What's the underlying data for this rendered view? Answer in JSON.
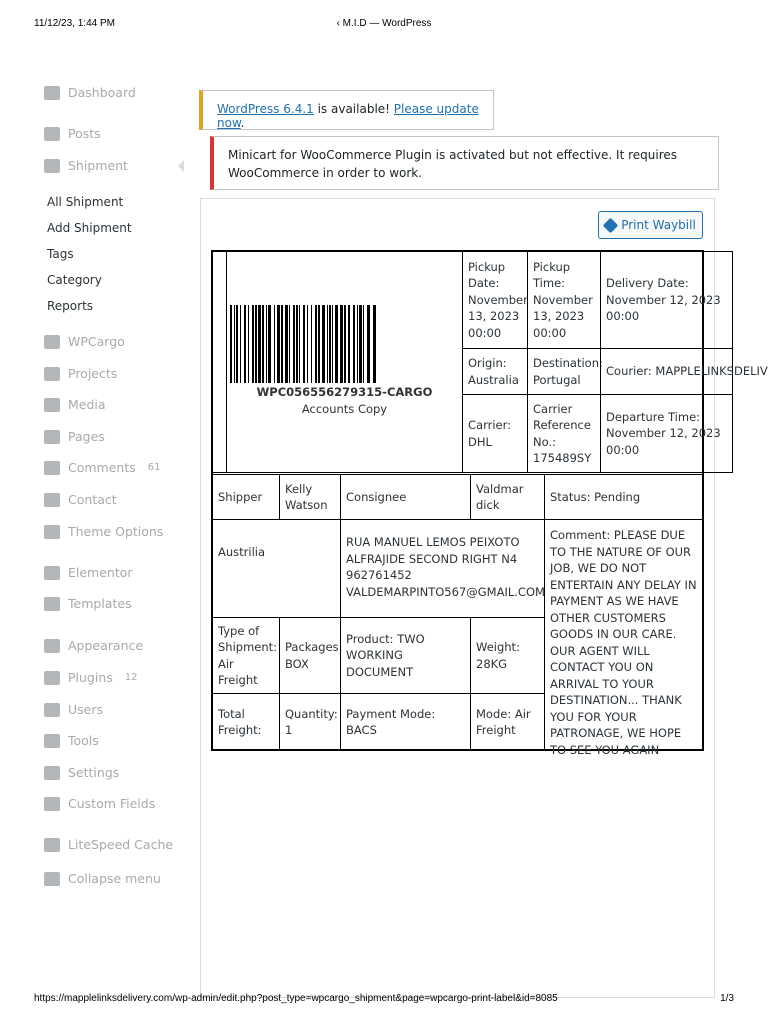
{
  "browser": {
    "datetime": "11/12/23, 1:44 PM",
    "title": "‹ M.I.D — WordPress",
    "url": "https://mapplelinksdelivery.com/wp-admin/edit.php?post_type=wpcargo_shipment&page=wpcargo-print-label&id=8085",
    "page": "1/3"
  },
  "sidebar": {
    "items": [
      {
        "label": "Dashboard",
        "icon": "dashboard-icon"
      },
      {
        "label": "Posts",
        "icon": "pin-icon"
      },
      {
        "label": "Shipment",
        "icon": "shipment-icon"
      },
      {
        "label": "WPCargo",
        "icon": "book-icon"
      },
      {
        "label": "Projects",
        "icon": "folder-icon"
      },
      {
        "label": "Media",
        "icon": "media-icon"
      },
      {
        "label": "Pages",
        "icon": "pages-icon"
      },
      {
        "label": "Comments",
        "icon": "comment-icon",
        "count": "61"
      },
      {
        "label": "Contact",
        "icon": "mail-icon"
      },
      {
        "label": "Theme Options",
        "icon": "gear-icon"
      },
      {
        "label": "Elementor",
        "icon": "elementor-icon"
      },
      {
        "label": "Templates",
        "icon": "folder-icon"
      },
      {
        "label": "Appearance",
        "icon": "brush-icon"
      },
      {
        "label": "Plugins",
        "icon": "plugin-icon",
        "count": "12"
      },
      {
        "label": "Users",
        "icon": "user-icon"
      },
      {
        "label": "Tools",
        "icon": "wrench-icon"
      },
      {
        "label": "Settings",
        "icon": "settings-icon"
      },
      {
        "label": "Custom Fields",
        "icon": "fields-icon"
      },
      {
        "label": "LiteSpeed Cache",
        "icon": "litespeed-icon"
      },
      {
        "label": "Collapse menu",
        "icon": "collapse-icon"
      }
    ],
    "submenu": [
      "All Shipment",
      "Add Shipment",
      "Tags",
      "Category",
      "Reports"
    ]
  },
  "notices": {
    "update_link": "WordPress 6.4.1",
    "update_mid": " is available! ",
    "update_action": "Please update now",
    "update_end": ".",
    "error": "Minicart for WooCommerce Plugin is activated but not effective. It requires WooCommerce in order to work."
  },
  "print_button": "Print Waybill",
  "label": {
    "tracking": "WPC056556279315-CARGO",
    "copy": "Accounts Copy",
    "pickup_date": "Pickup Date: November 13, 2023 00:00",
    "pickup_time": "Pickup Time: November 13, 2023 00:00",
    "delivery_date": "Delivery Date: November 12, 2023 00:00",
    "origin": "Origin: Australia",
    "destination": "Destination: Portugal",
    "courier": "Courier: MAPPLELINKSDELIVERY",
    "carrier": "Carrier: DHL",
    "carrier_ref": "Carrier Reference No.: 175489SY",
    "departure": "Departure Time: November 12, 2023 00:00",
    "shipper_label": "Shipper",
    "shipper": "Kelly Watson",
    "consignee_label": "Consignee",
    "consignee": "Valdmar dick",
    "status": "Status: Pending",
    "shipper_address": "Austrilia",
    "consignee_address": "RUA MANUEL LEMOS PEIXOTO ALFRAJIDE SECOND RIGHT N4 962761452 VALDEMARPINTO567@GMAIL.COM",
    "comment": "Comment: PLEASE DUE TO THE NATURE OF OUR JOB, WE DO NOT ENTERTAIN ANY DELAY IN PAYMENT AS WE HAVE OTHER CUSTOMERS GOODS IN OUR CARE. OUR AGENT WILL CONTACT YOU ON ARRIVAL TO YOUR DESTINATION... THANK YOU FOR YOUR PATRONAGE, WE HOPE TO SEE YOU AGAIN",
    "type": "Type of Shipment: Air Freight",
    "packages": "Packages: BOX",
    "product": "Product: TWO WORKING DOCUMENT",
    "weight": "Weight: 28KG",
    "total": "Total Freight:",
    "quantity": "Quantity: 1",
    "payment": "Payment Mode: BACS",
    "mode": "Mode: Air Freight"
  }
}
